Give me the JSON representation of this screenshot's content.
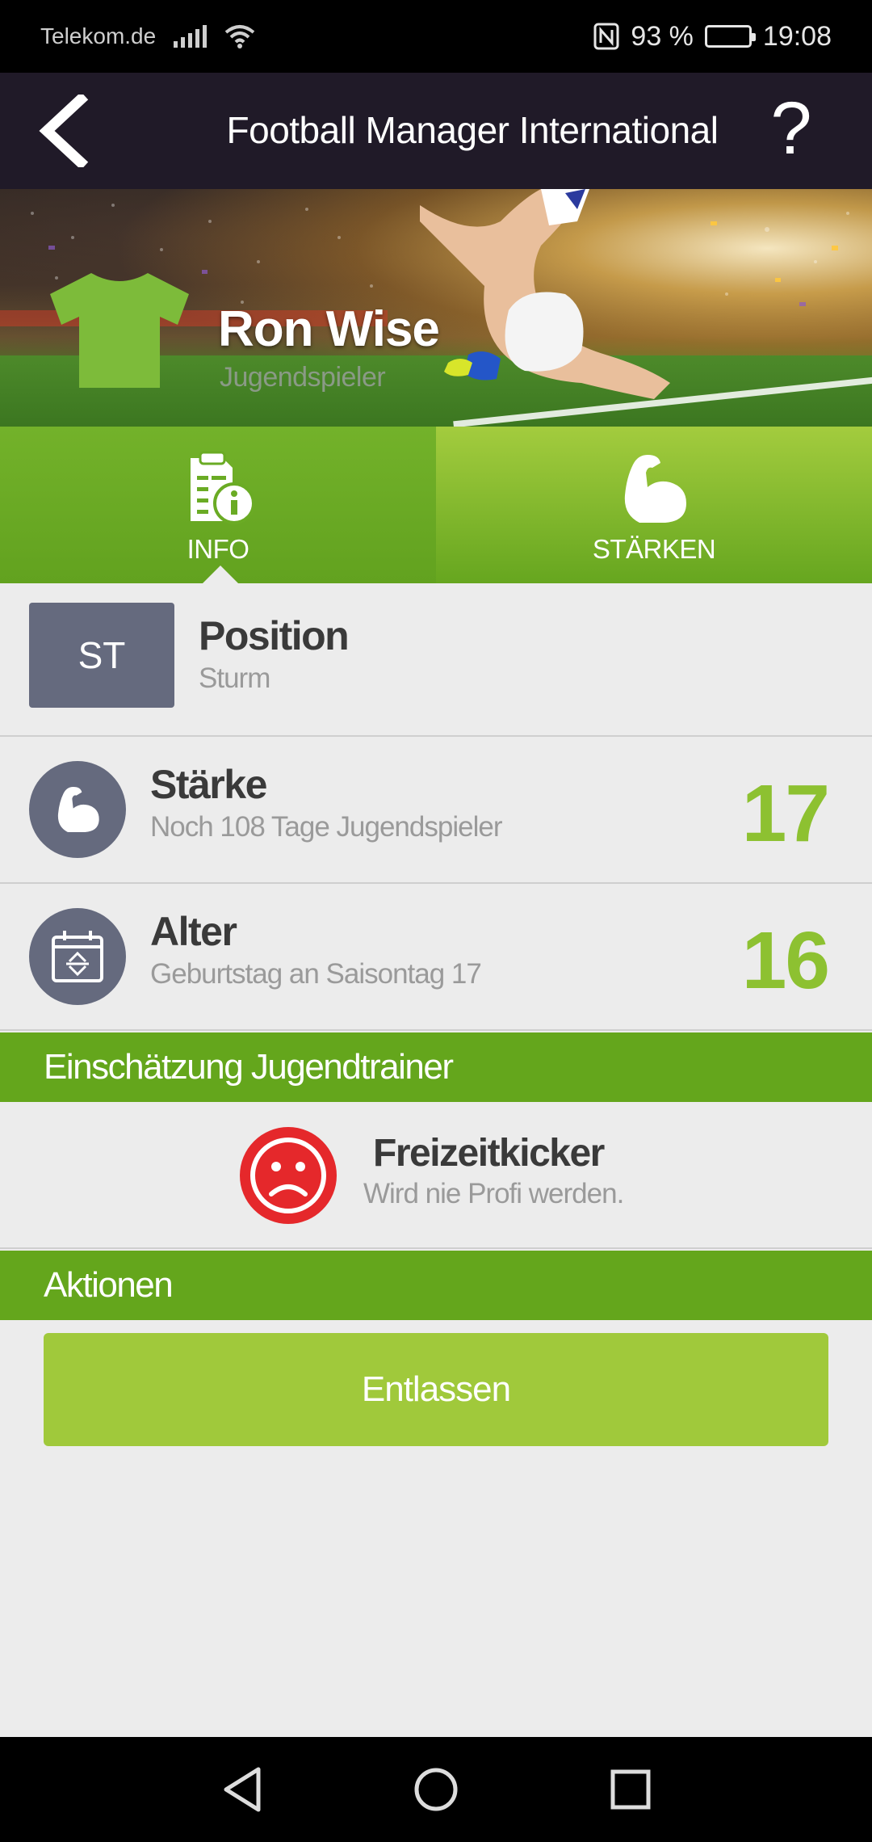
{
  "status_bar": {
    "carrier": "Telekom.de",
    "battery": "93 %",
    "time": "19:08",
    "icons": [
      "signal-icon",
      "wifi-icon",
      "nfc-icon",
      "battery-icon"
    ]
  },
  "app_bar": {
    "title": "Football Manager International",
    "help": "?",
    "icons": [
      "back-arrow-icon"
    ]
  },
  "player": {
    "name": "Ron Wise",
    "role": "Jugendspieler",
    "shirt_color": "#7dbb3a"
  },
  "tabs": [
    {
      "label": "INFO",
      "icon": "info-sheet-icon",
      "active": true
    },
    {
      "label": "STÄRKEN",
      "icon": "bicep-icon",
      "active": false
    }
  ],
  "rows": {
    "position": {
      "badge": "ST",
      "title": "Position",
      "subtitle": "Sturm"
    },
    "staerke": {
      "title": "Stärke",
      "subtitle": "Noch 108 Tage Jugendspieler",
      "value": "17",
      "icon": "bicep-icon"
    },
    "alter": {
      "title": "Alter",
      "subtitle": "Geburtstag an Saisontag 17",
      "value": "16",
      "icon": "calendar-icon"
    }
  },
  "sections": {
    "trainer": "Einschätzung Jugendtrainer",
    "aktionen": "Aktionen"
  },
  "assessment": {
    "title": "Freizeitkicker",
    "subtitle": "Wird nie Profi werden.",
    "icon": "sad-face-icon",
    "color": "#e5282b"
  },
  "actions": {
    "fire_label": "Entlassen"
  },
  "colors": {
    "accent_green": "#64a61c",
    "value_green": "#8dc131",
    "button_green": "#a0c93b",
    "badge_gray": "#656a7e",
    "app_bar": "#201a28"
  },
  "nav_bar": {
    "icons": [
      "nav-back-icon",
      "nav-home-icon",
      "nav-recent-icon"
    ]
  }
}
